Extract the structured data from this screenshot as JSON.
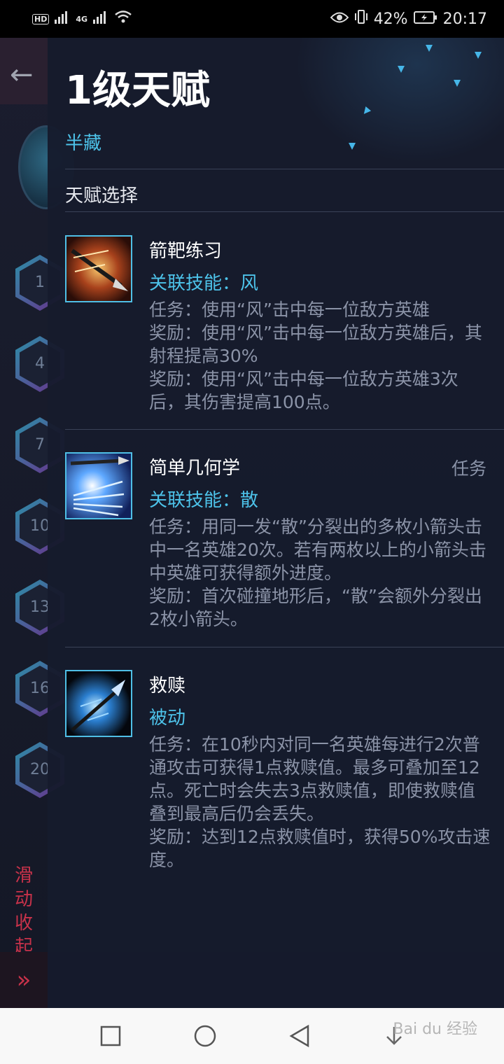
{
  "status_bar": {
    "hd": "HD",
    "network": "4G",
    "battery_percent": "42%",
    "time": "20:17"
  },
  "background_app": {
    "slide_collapse": [
      "滑",
      "动",
      "收",
      "起"
    ],
    "hex_levels": [
      "1",
      "4",
      "7",
      "10",
      "13",
      "16",
      "20"
    ]
  },
  "panel": {
    "title": "1级天赋",
    "hero_name": "半藏",
    "section_title": "天赋选择",
    "talents": [
      {
        "name": "箭靶练习",
        "tag": "",
        "skill": "关联技能：风",
        "desc": [
          "任务：使用“风”击中每一位敌方英雄",
          "奖励：使用“风”击中每一位敌方英雄后，其射程提高30%",
          "奖励：使用“风”击中每一位敌方英雄3次后，其伤害提高100点。"
        ]
      },
      {
        "name": "简单几何学",
        "tag": "任务",
        "skill": "关联技能：散",
        "desc": [
          "任务：用同一发“散”分裂出的多枚小箭头击中一名英雄20次。若有两枚以上的小箭头击中英雄可获得额外进度。",
          "奖励：首次碰撞地形后，“散”会额外分裂出2枚小箭头。"
        ]
      },
      {
        "name": "救赎",
        "tag": "",
        "skill": "被动",
        "desc": [
          "任务：在10秒内对同一名英雄每进行2次普通攻击可获得1点救赎值。最多可叠加至12点。死亡时会失去3点救赎值，即使救赎值叠到最高后仍会丢失。",
          "奖励：达到12点救赎值时，获得50%攻击速度。"
        ]
      }
    ]
  },
  "watermark": "Bai du 经验",
  "colors": {
    "accent": "#4dc3ea",
    "panel_bg": "#161b2d",
    "collapse_red": "#c8324a"
  }
}
